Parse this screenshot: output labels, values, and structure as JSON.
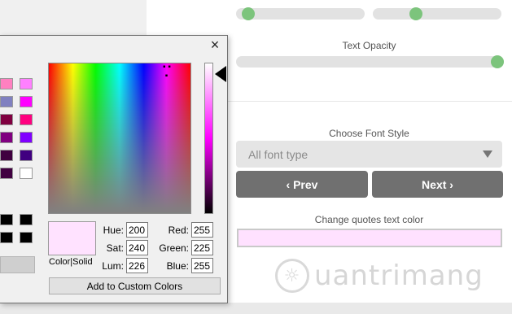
{
  "settings_panel": {
    "text_opacity_label": "Text Opacity",
    "choose_font_style_label": "Choose Font Style",
    "font_select_value": "All font type",
    "prev_button": "‹ Prev",
    "next_button": "Next ›",
    "quote_color_label": "Change quotes text color",
    "quote_color_value": "#ffe1ff",
    "sliders": [
      {
        "name": "top-left-slider",
        "value": 0.08
      },
      {
        "name": "top-right-slider",
        "value": 0.33
      },
      {
        "name": "text-opacity-slider",
        "value": 1.0
      }
    ]
  },
  "color_dialog": {
    "close_glyph": "×",
    "preview_label": "Color|Solid",
    "fields": {
      "hue_label": "Hue:",
      "hue": "200",
      "sat_label": "Sat:",
      "sat": "240",
      "lum_label": "Lum:",
      "lum": "226",
      "red_label": "Red:",
      "red": "255",
      "green_label": "Green:",
      "green": "225",
      "blue_label": "Blue:",
      "blue": "255"
    },
    "add_custom_button": "Add to Custom Colors",
    "basic_colors": [
      [
        "#ff80c0",
        "#ff80ff"
      ],
      [
        "#8080c0",
        "#ff00ff"
      ],
      [
        "#800040",
        "#ff0080"
      ],
      [
        "#800080",
        "#8000ff"
      ],
      [
        "#400040",
        "#400080"
      ],
      [
        "#400040",
        "#ffffff"
      ]
    ],
    "custom_colors": [
      [
        "#000000",
        "#000000"
      ],
      [
        "#000000",
        "#000000"
      ]
    ],
    "preview_color": "#ffe2ff"
  },
  "watermark": {
    "text": "uantrimang"
  }
}
